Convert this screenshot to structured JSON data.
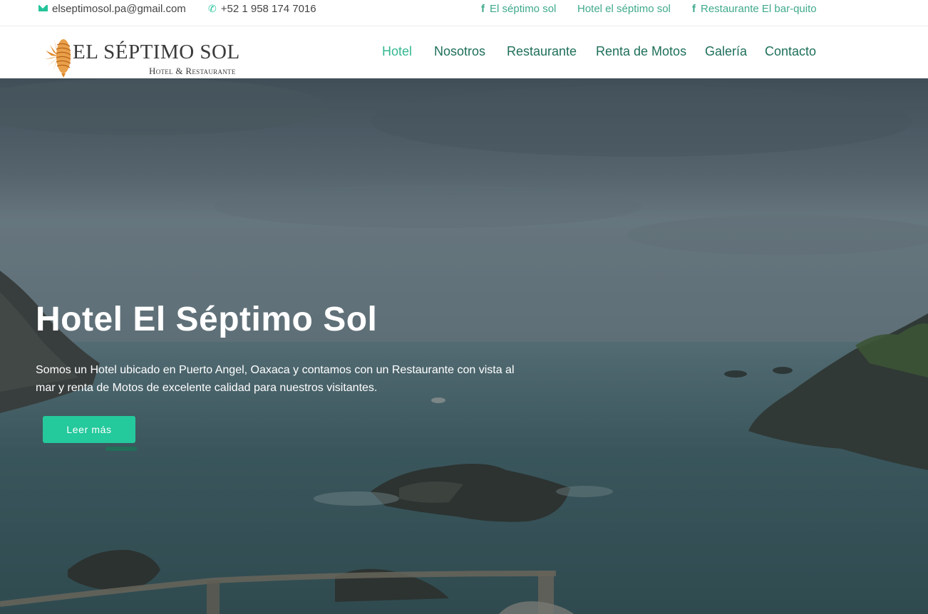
{
  "topbar": {
    "email": "elseptimosol.pa@gmail.com",
    "phone": "+52 1 958 174 7016",
    "social": [
      {
        "label": "El séptimo sol",
        "icon": "facebook-icon"
      },
      {
        "label": "Hotel el séptimo sol",
        "icon": ""
      },
      {
        "label": "Restaurante El bar-quito",
        "icon": "facebook-icon"
      }
    ]
  },
  "logo": {
    "title": "EL SÉPTIMO SOL",
    "subtitle": "Hotel & Restaurante"
  },
  "nav": {
    "items": [
      {
        "label": "Hotel",
        "active": true
      },
      {
        "label": "Nosotros",
        "active": false
      },
      {
        "label": "Restaurante",
        "active": false
      },
      {
        "label": "Renta de Motos",
        "active": false
      },
      {
        "label": "Galería",
        "active": false
      },
      {
        "label": "Contacto",
        "active": false
      }
    ]
  },
  "hero": {
    "title": "Hotel El Séptimo Sol",
    "text": "Somos un Hotel ubicado en Puerto Angel, Oaxaca y contamos con un Restaurante con vista al mar y renta de Motos de excelente calidad para nuestros visitantes.",
    "button": "Leer más"
  },
  "colors": {
    "accent": "#24c99c",
    "nav_text": "#1e6f5a",
    "nav_active": "#34b890",
    "social_text": "#3fa98c",
    "logo_orange": "#e08a2a"
  }
}
